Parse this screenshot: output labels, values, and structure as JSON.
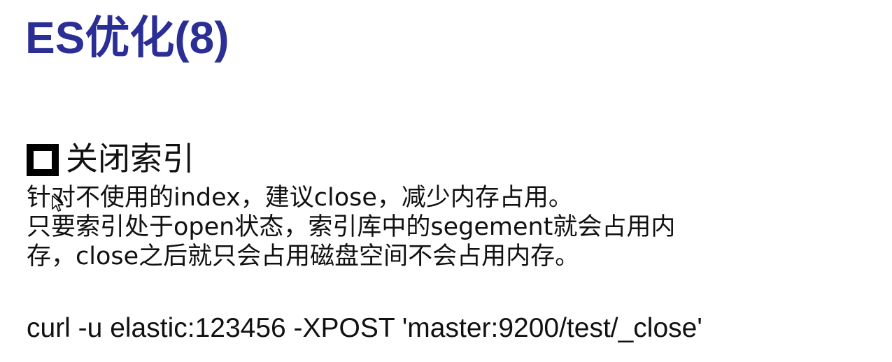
{
  "slide": {
    "title": "ES优化(8)",
    "section_heading": "关闭索引",
    "body_lines": [
      "针对不使用的index，建议close，减少内存占用。",
      "只要索引处于open状态，索引库中的segement就会占用内",
      "存，close之后就只会占用磁盘空间不会占用内存。"
    ],
    "command": "curl -u elastic:123456  -XPOST 'master:9200/test/_close'"
  },
  "colors": {
    "title": "#2b2f95",
    "text": "#111111",
    "background": "#ffffff"
  },
  "icons": {
    "bullet": "square-bullet-icon",
    "pointer": "mouse-cursor-icon"
  }
}
